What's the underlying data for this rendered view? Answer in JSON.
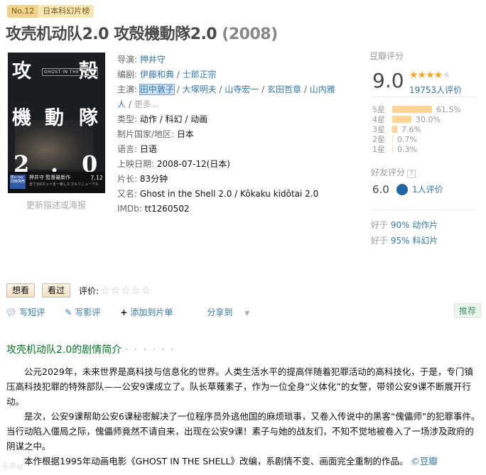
{
  "rank": {
    "no": "No.12",
    "list": "日本科幻片榜"
  },
  "title": {
    "main": "攻壳机动队2.0 攻殻機動隊2.0",
    "year": "(2008)"
  },
  "poster": {
    "chars": [
      "攻",
      "殻",
      "機",
      "動",
      "隊",
      "2",
      ".",
      "0"
    ],
    "logo": "GHOST IN THE SHELL",
    "bottom_line1": "押井守 監督最新作",
    "bottom_line2": "全ての0カットを一新したフルリニューアル",
    "bottom_badge": "Blu-ray 同時発売",
    "date": "7.12",
    "link": "更新描述或海报"
  },
  "info": {
    "director_label": "导演:",
    "director": [
      "押井守"
    ],
    "writer_label": "编剧:",
    "writers": [
      "伊藤和典",
      "士郎正宗"
    ],
    "cast_label": "主演:",
    "cast_line1": [
      "田中敦子",
      "大塚明夫",
      "山寺宏一",
      "玄田哲章",
      "山内雅"
    ],
    "cast_line2": "人",
    "more": "更多...",
    "genre_label": "类型:",
    "genres": "动作 / 科幻 / 动画",
    "country_label": "制片国家/地区:",
    "country": "日本",
    "lang_label": "语言:",
    "lang": "日语",
    "release_label": "上映日期:",
    "release": "2008-07-12(日本)",
    "runtime_label": "片长:",
    "runtime": "83分钟",
    "aka_label": "又名:",
    "aka": "Ghost in the Shell 2.0 / Kôkaku kidôtai 2.0",
    "imdb_label": "IMDb:",
    "imdb": "tt1260502"
  },
  "rating": {
    "label": "豆瓣评分",
    "score": "9.0",
    "stars": 4.5,
    "votes": "19753人评价",
    "distribution": [
      {
        "label": "5星",
        "pct": 61.5,
        "text": "61.5%"
      },
      {
        "label": "4星",
        "pct": 30.0,
        "text": "30.0%"
      },
      {
        "label": "3星",
        "pct": 7.6,
        "text": "7.6%"
      },
      {
        "label": "2星",
        "pct": 0.7,
        "text": "0.7%"
      },
      {
        "label": "1星",
        "pct": 0.3,
        "text": "0.3%"
      }
    ]
  },
  "friend": {
    "label": "好友评分",
    "help": "?",
    "score": "6.0",
    "count": "1人评价"
  },
  "better": [
    {
      "prefix": "好于 ",
      "pct": "90%",
      "genre": " 动作片"
    },
    {
      "prefix": "好于 ",
      "pct": "95%",
      "genre": " 科幻片"
    }
  ],
  "actions": {
    "want": "想看",
    "seen": "看过",
    "rate_label": "评价:",
    "rate_stars": "☆☆☆☆☆"
  },
  "links": {
    "short_review": "写短评",
    "review": "写影评",
    "add_list": "添加到片单",
    "share": "分享到",
    "recommend": "推荐"
  },
  "summary": {
    "title": "攻壳机动队2.0的剧情简介",
    "dots": "· · · · · ·",
    "p1": "公元2029年，未来世界是高科技与信息化的世界。人类生活水平的提高伴随着犯罪活动的高科技化，于是，专门镇压高科技犯罪的特殊部队——公安9课成立了。队长草薙素子，作为一位全身“义体化”的女警，带领公安9课不断展开行动。",
    "p2": "是次，公安9课帮助公安6课秘密解决了一位程序员外逃他国的麻烦琐事，又卷入传说中的黑客“傀儡师”的犯罪事件。当行动陷入僵局之际，傀儡师竟然不请自来，出现在公安9课！素子与她的战友们，不知不觉地被卷入了一场涉及政府的阴谋之中。",
    "p3": "本作根据1995年动画电影《GHOST IN THE SHELL》改编，系剧情不变、画面完全重制的作品。",
    "source": "©豆瓣"
  },
  "watermark": "头条@"
}
